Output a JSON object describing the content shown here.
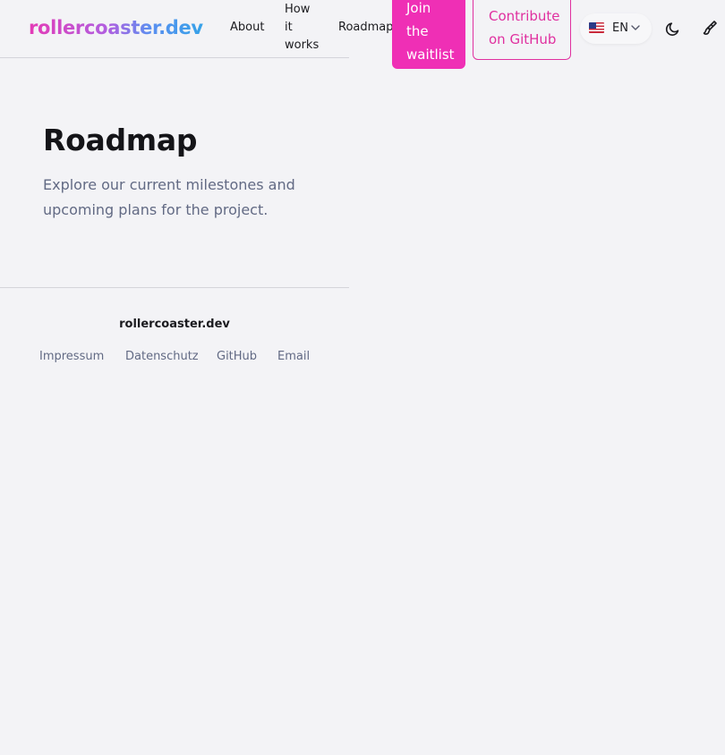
{
  "header": {
    "logo": "rollercoaster.dev",
    "nav": {
      "about": "About",
      "how_it_works": "How it works",
      "roadmap": "Roadmap"
    },
    "cta_waitlist": "Join the waitlist",
    "cta_github": "Contribute on GitHub",
    "language": {
      "flag_icon": "us-flag-icon",
      "selected": "EN"
    },
    "icons": {
      "theme": "moon-icon",
      "customize": "paintbrush-icon"
    }
  },
  "main": {
    "title": "Roadmap",
    "subtitle": "Explore our current milestones and upcoming plans for the project."
  },
  "footer": {
    "brand": "rollercoaster.dev",
    "links": [
      "Impressum",
      "Datenschutz",
      "GitHub",
      "Email"
    ]
  },
  "colors": {
    "background": "#f3f3f6",
    "accent": "#ef2fb5",
    "muted_text": "#626a84"
  }
}
